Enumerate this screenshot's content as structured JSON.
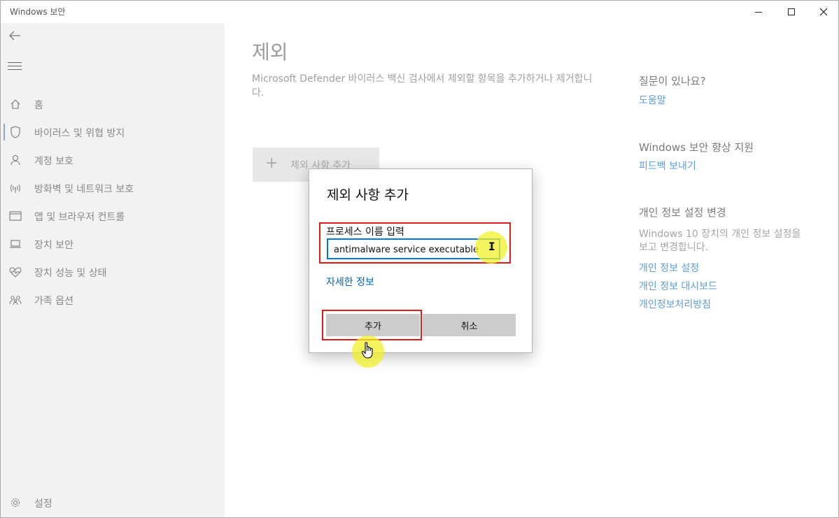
{
  "window": {
    "title": "Windows 보안"
  },
  "sidebar": {
    "back_icon": "back-arrow-icon",
    "menu_icon": "hamburger-menu-icon",
    "items": [
      {
        "label": "홈",
        "icon": "home-icon",
        "active": false
      },
      {
        "label": "바이러스 및 위협 방지",
        "icon": "shield-icon",
        "active": true
      },
      {
        "label": "계정 보호",
        "icon": "person-icon",
        "active": false
      },
      {
        "label": "방화벽 및 네트워크 보호",
        "icon": "wireless-icon",
        "active": false
      },
      {
        "label": "앱 및 브라우저 컨트롤",
        "icon": "app-browser-icon",
        "active": false
      },
      {
        "label": "장치 보안",
        "icon": "laptop-icon",
        "active": false
      },
      {
        "label": "장치 성능 및 상태",
        "icon": "heart-pulse-icon",
        "active": false
      },
      {
        "label": "가족 옵션",
        "icon": "family-icon",
        "active": false
      }
    ],
    "settings_label": "설정",
    "settings_icon": "gear-icon"
  },
  "main": {
    "title": "제외",
    "description": "Microsoft Defender 바이러스 백신 검사에서 제외할 항목을 추가하거나 제거합니다.",
    "add_exclusion_label": "제외 사항 추가",
    "add_exclusion_icon": "plus-icon"
  },
  "right": {
    "help_heading": "질문이 있나요?",
    "help_link": "도움말",
    "improve_heading": "Windows 보안 향상 지원",
    "feedback_link": "피드백 보내기",
    "privacy_heading": "개인 정보 설정 변경",
    "privacy_text": "Windows 10 장치의 개인 정보 설정을 보고 변경합니다.",
    "privacy_settings_link": "개인 정보 설정",
    "privacy_dashboard_link": "개인 정보 대시보드",
    "privacy_policy_link": "개인정보처리방침"
  },
  "dialog": {
    "title": "제외 사항 추가",
    "field_label": "프로세스 이름 입력",
    "field_value": "antimalware service executable",
    "clear_icon": "clear-x-icon",
    "more_info_link": "자세한 정보",
    "add_button": "추가",
    "cancel_button": "취소"
  },
  "colors": {
    "accent": "#0078d7",
    "link": "#0067b8",
    "highlight_box": "#e01b1b",
    "cursor_highlight": "#f0f028"
  }
}
